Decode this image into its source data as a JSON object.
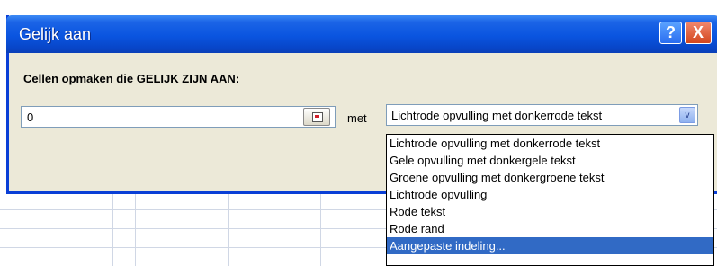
{
  "dialog": {
    "title": "Gelijk aan",
    "help_symbol": "?",
    "close_symbol": "X",
    "prompt": "Cellen opmaken die GELIJK ZIJN AAN:",
    "value_input": "0",
    "with_label": "met",
    "format_select": {
      "selected": "Lichtrode opvulling met donkerrode tekst",
      "arrow_symbol": "v",
      "options": [
        "Lichtrode opvulling met donkerrode tekst",
        "Gele opvulling met donkergele tekst",
        "Groene opvulling met donkergroene tekst",
        "Lichtrode opvulling",
        "Rode tekst",
        "Rode rand",
        "Aangepaste indeling..."
      ]
    }
  }
}
